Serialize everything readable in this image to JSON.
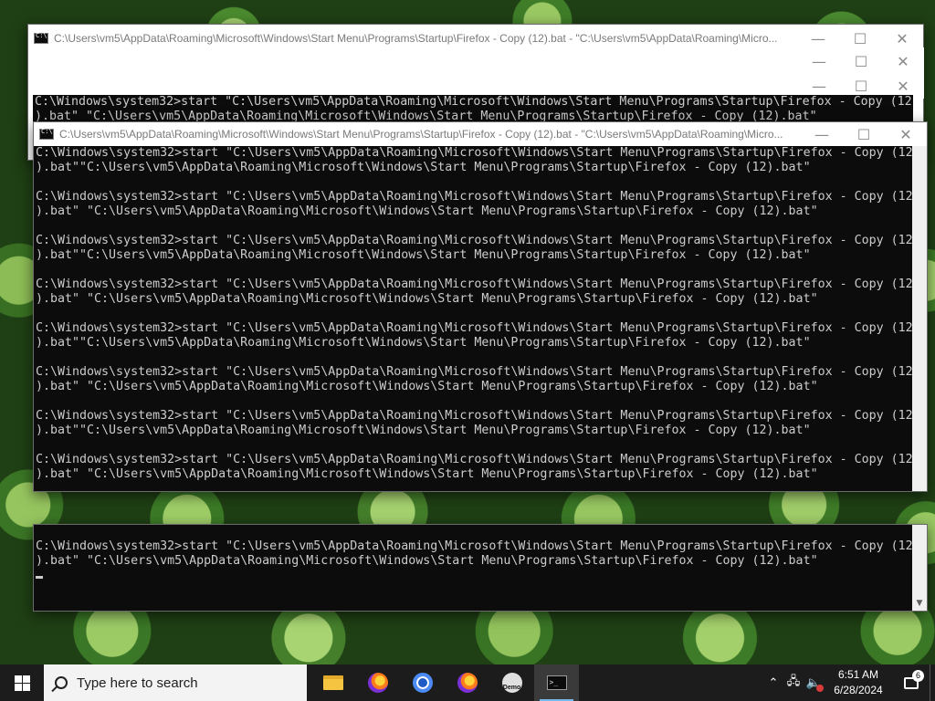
{
  "window_title": "C:\\Users\\vm5\\AppData\\Roaming\\Microsoft\\Windows\\Start Menu\\Programs\\Startup\\Firefox - Copy (12).bat - \"C:\\Users\\vm5\\AppData\\Roaming\\Micro...",
  "window_controls": {
    "minimize": "—",
    "maximize": "☐",
    "close": "✕"
  },
  "back_console_lines": [
    "C:\\Windows\\system32>start \"C:\\Users\\vm5\\AppData\\Roaming\\Microsoft\\Windows\\Start Menu\\Programs\\Startup\\Firefox - Copy (12",
    ").bat\" \"C:\\Users\\vm5\\AppData\\Roaming\\Microsoft\\Windows\\Start Menu\\Programs\\Startup\\Firefox - Copy (12).bat\""
  ],
  "front_console_lines": [
    "C:\\Windows\\system32>start \"C:\\Users\\vm5\\AppData\\Roaming\\Microsoft\\Windows\\Start Menu\\Programs\\Startup\\Firefox - Copy (12",
    ").bat\"\"C:\\Users\\vm5\\AppData\\Roaming\\Microsoft\\Windows\\Start Menu\\Programs\\Startup\\Firefox - Copy (12).bat\"",
    "",
    "C:\\Windows\\system32>start \"C:\\Users\\vm5\\AppData\\Roaming\\Microsoft\\Windows\\Start Menu\\Programs\\Startup\\Firefox - Copy (12",
    ").bat\" \"C:\\Users\\vm5\\AppData\\Roaming\\Microsoft\\Windows\\Start Menu\\Programs\\Startup\\Firefox - Copy (12).bat\"",
    "",
    "C:\\Windows\\system32>start \"C:\\Users\\vm5\\AppData\\Roaming\\Microsoft\\Windows\\Start Menu\\Programs\\Startup\\Firefox - Copy (12",
    ").bat\"\"C:\\Users\\vm5\\AppData\\Roaming\\Microsoft\\Windows\\Start Menu\\Programs\\Startup\\Firefox - Copy (12).bat\"",
    "",
    "C:\\Windows\\system32>start \"C:\\Users\\vm5\\AppData\\Roaming\\Microsoft\\Windows\\Start Menu\\Programs\\Startup\\Firefox - Copy (12",
    ").bat\" \"C:\\Users\\vm5\\AppData\\Roaming\\Microsoft\\Windows\\Start Menu\\Programs\\Startup\\Firefox - Copy (12).bat\"",
    "",
    "C:\\Windows\\system32>start \"C:\\Users\\vm5\\AppData\\Roaming\\Microsoft\\Windows\\Start Menu\\Programs\\Startup\\Firefox - Copy (12",
    ").bat\"\"C:\\Users\\vm5\\AppData\\Roaming\\Microsoft\\Windows\\Start Menu\\Programs\\Startup\\Firefox - Copy (12).bat\"",
    "",
    "C:\\Windows\\system32>start \"C:\\Users\\vm5\\AppData\\Roaming\\Microsoft\\Windows\\Start Menu\\Programs\\Startup\\Firefox - Copy (12",
    ").bat\" \"C:\\Users\\vm5\\AppData\\Roaming\\Microsoft\\Windows\\Start Menu\\Programs\\Startup\\Firefox - Copy (12).bat\"",
    "",
    "C:\\Windows\\system32>start \"C:\\Users\\vm5\\AppData\\Roaming\\Microsoft\\Windows\\Start Menu\\Programs\\Startup\\Firefox - Copy (12",
    ").bat\"\"C:\\Users\\vm5\\AppData\\Roaming\\Microsoft\\Windows\\Start Menu\\Programs\\Startup\\Firefox - Copy (12).bat\"",
    "",
    "C:\\Windows\\system32>start \"C:\\Users\\vm5\\AppData\\Roaming\\Microsoft\\Windows\\Start Menu\\Programs\\Startup\\Firefox - Copy (12",
    ").bat\" \"C:\\Users\\vm5\\AppData\\Roaming\\Microsoft\\Windows\\Start Menu\\Programs\\Startup\\Firefox - Copy (12).bat\""
  ],
  "bottom_console_lines": [
    "C:\\Windows\\system32>start \"C:\\Users\\vm5\\AppData\\Roaming\\Microsoft\\Windows\\Start Menu\\Programs\\Startup\\Firefox - Copy (12",
    ").bat\" \"C:\\Users\\vm5\\AppData\\Roaming\\Microsoft\\Windows\\Start Menu\\Programs\\Startup\\Firefox - Copy (12).bat\""
  ],
  "taskbar": {
    "search_placeholder": "Type here to search",
    "apps": [
      {
        "name": "file-explorer",
        "icon": "folder-icon",
        "active": false
      },
      {
        "name": "firefox-nightly",
        "icon": "firefox-icon",
        "active": false
      },
      {
        "name": "chrome",
        "icon": "chrome-icon",
        "active": false
      },
      {
        "name": "firefox",
        "icon": "firefox-icon",
        "active": false
      },
      {
        "name": "demo",
        "icon": "demo-icon",
        "label": "Demo",
        "active": false
      },
      {
        "name": "command-prompt",
        "icon": "terminal-icon",
        "active": true
      }
    ],
    "tray_icons": [
      "chevron-up-icon",
      "network-icon",
      "volume-muted-icon"
    ],
    "time": "6:51 AM",
    "date": "6/28/2024",
    "notification_count": "6"
  }
}
